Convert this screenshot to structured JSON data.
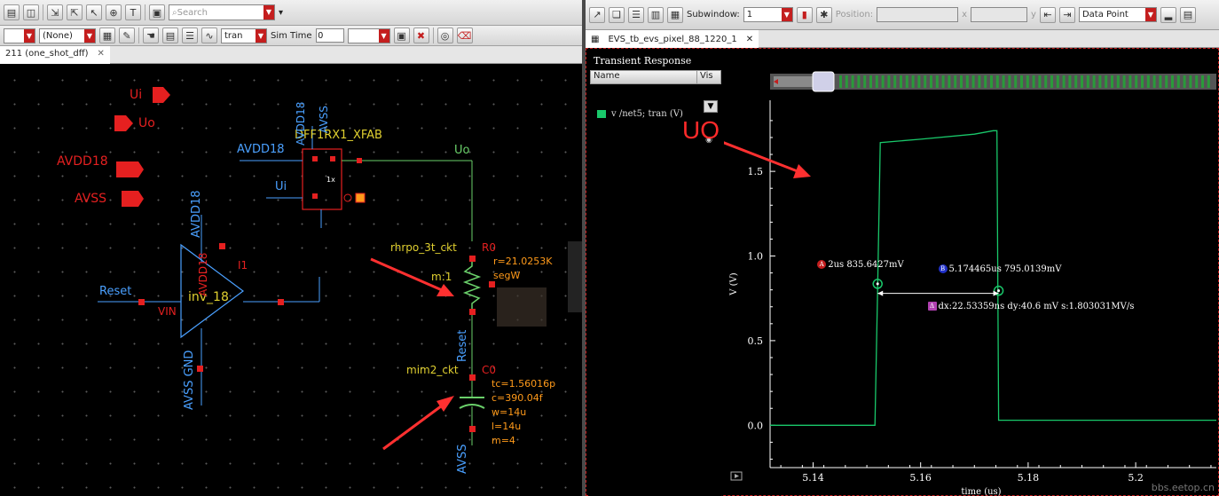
{
  "left": {
    "search_placeholder": "Search",
    "filter_value": "(None)",
    "analysis_value": "tran",
    "sim_time_label": "Sim Time",
    "sim_time_value": "0",
    "tab_label": "211 (one_shot_dff)"
  },
  "schematic": {
    "pins": [
      "Ui",
      "Uo",
      "AVDD18",
      "AVSS"
    ],
    "dff_name": "DFF1RX1_XFAB",
    "dff_avdd": "AVDD18",
    "dff_avss": "AVSS",
    "dff_in_label": "Ui",
    "dff_inner": "1x",
    "net_uo": "Uo",
    "inv_name": "inv_18",
    "inv_avdd": "AVDD18",
    "inv_avdd2": "AVDD18",
    "inv_gnd": "AVSS GND",
    "inv_vin": "VIN",
    "inv_inst": "I1",
    "reset_label": "Reset",
    "reset_net": "Reset",
    "res_cell": "rhrpo_3t_ckt",
    "res_inst": "R0",
    "res_r": "r=21.0253K",
    "res_seg": "segW",
    "res_avdd": "AVDD18",
    "res_m": "m:1",
    "cap_cell": "mim2_ckt",
    "cap_inst": "C0",
    "cap_params": [
      "tc=1.56016p",
      "c=390.04f",
      "w=14u",
      "l=14u",
      "m=4"
    ],
    "cap_avss": "AVSS"
  },
  "right": {
    "subwindow_label": "Subwindow:",
    "subwindow_value": "1",
    "position_label": "Position:",
    "x_label": "x",
    "y_label": "y",
    "datapoint_value": "Data Point",
    "tab_label": "EVS_tb_evs_pixel_88_1220_1",
    "pane_title": "Transient Response",
    "col_name": "Name",
    "col_vis": "Vis",
    "signal_name": "v /net5; tran (V)",
    "signal_color": "#19c86a",
    "annotation": "UO",
    "watermark": "bbs.eetop.cn"
  },
  "markers": {
    "a_badge": "A",
    "a_label": "2us 835.6427mV",
    "b_badge": "B",
    "b_label": "5.174465us 795.0139mV",
    "delta_badge": "Δ",
    "delta_label": "dx:22.53359ns dy:40.6  mV s:1.803031MV/s"
  },
  "chart_data": {
    "type": "line",
    "title": "",
    "xlabel": "time (us)",
    "ylabel": "V (V)",
    "xlim": [
      5.132,
      5.215
    ],
    "ylim": [
      -0.25,
      1.92
    ],
    "xticks": [
      5.14,
      5.16,
      5.18,
      5.2
    ],
    "yticks": [
      0.0,
      0.5,
      1.0,
      1.5
    ],
    "xtick_labels": [
      "5.14",
      "5.16",
      "5.18",
      "5.2"
    ],
    "ytick_labels": [
      "0.0",
      "0.5",
      "1.0",
      "1.5"
    ],
    "grid": false,
    "legend": "none",
    "series": [
      {
        "name": "v /net5; tran (V)",
        "color": "#19c86a",
        "x": [
          5.132,
          5.1515,
          5.152,
          5.1525,
          5.16,
          5.17,
          5.1735,
          5.1742,
          5.1745,
          5.176,
          5.19,
          5.21,
          5.215
        ],
        "y": [
          0.0,
          0.0,
          0.8,
          1.67,
          1.69,
          1.72,
          1.74,
          1.74,
          0.03,
          0.03,
          0.03,
          0.03,
          0.03
        ]
      }
    ]
  }
}
